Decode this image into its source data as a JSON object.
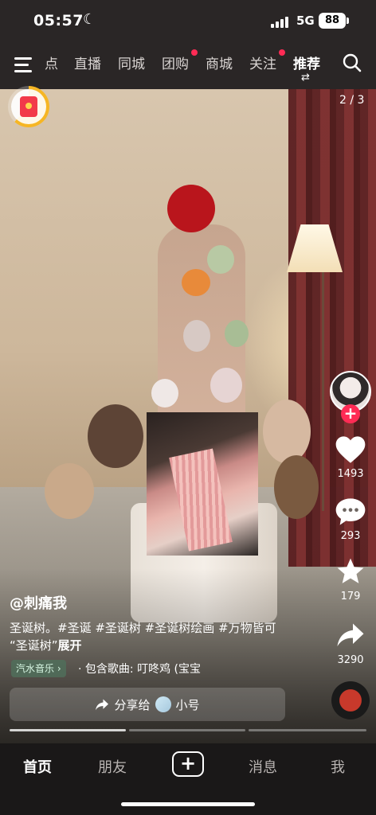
{
  "status_bar": {
    "time": "05:57",
    "network": "5G",
    "battery": "88"
  },
  "top_nav": {
    "tabs": [
      {
        "label": "点",
        "dot": false
      },
      {
        "label": "直播",
        "dot": false
      },
      {
        "label": "同城",
        "dot": false
      },
      {
        "label": "团购",
        "dot": true
      },
      {
        "label": "商城",
        "dot": false
      },
      {
        "label": "关注",
        "dot": true
      },
      {
        "label": "推荐",
        "dot": false,
        "active": true
      }
    ]
  },
  "video": {
    "page_counter": "2 / 3"
  },
  "right_rail": {
    "like_count": "1493",
    "comment_count": "293",
    "favorite_count": "179",
    "share_count": "3290"
  },
  "caption": {
    "author": "@刺痛我",
    "text_line1": "圣诞树。#圣诞 #圣诞树 #圣诞树绘画 #万物皆可",
    "text_line2": "“圣诞树”",
    "expand": "展开"
  },
  "music": {
    "chip": "汽水音乐 ›",
    "song": "· 包含歌曲: 叮咚鸡 (宝宝"
  },
  "share_bar": {
    "label": "分享给",
    "target": "小号"
  },
  "bottom_nav": {
    "items": [
      {
        "label": "首页",
        "active": true
      },
      {
        "label": "朋友"
      },
      {
        "label": "+"
      },
      {
        "label": "消息"
      },
      {
        "label": "我"
      }
    ]
  },
  "colors": {
    "accent": "#ff2b55",
    "redpack": "#f23a4a",
    "ring": "#f6b624"
  },
  "icons": [
    "menu-icon",
    "search-icon",
    "swap-icon",
    "red-packet-icon",
    "heart-icon",
    "comment-icon",
    "star-icon",
    "share-icon",
    "share-arrow-icon",
    "plus-icon"
  ]
}
